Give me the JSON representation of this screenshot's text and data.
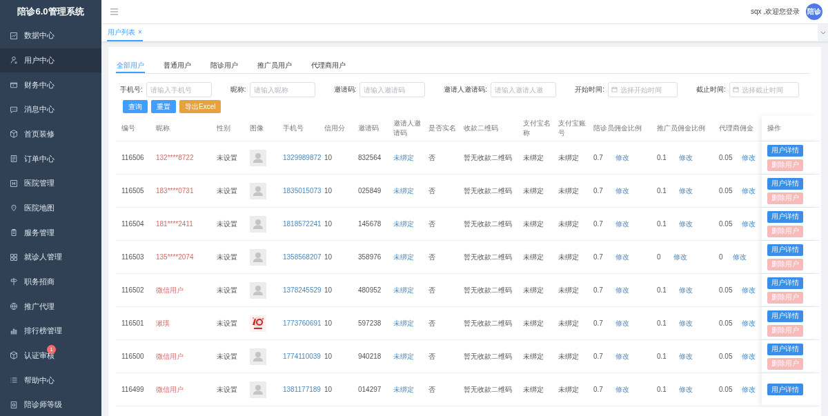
{
  "sidebar": {
    "title": "陪诊6.0管理系统",
    "items": [
      {
        "label": "数据中心",
        "selected": false
      },
      {
        "label": "用户中心",
        "selected": true
      },
      {
        "label": "财务中心",
        "selected": false
      },
      {
        "label": "消息中心",
        "selected": false
      },
      {
        "label": "首页装修",
        "selected": false
      },
      {
        "label": "订单中心",
        "selected": false
      },
      {
        "label": "医院管理",
        "selected": false
      },
      {
        "label": "医院地图",
        "selected": false
      },
      {
        "label": "服务管理",
        "selected": false
      },
      {
        "label": "就诊人管理",
        "selected": false
      },
      {
        "label": "职务招商",
        "selected": false
      },
      {
        "label": "推广代理",
        "selected": false
      },
      {
        "label": "排行榜管理",
        "selected": false
      },
      {
        "label": "认证审核",
        "selected": false,
        "badge": "1"
      },
      {
        "label": "帮助中心",
        "selected": false
      },
      {
        "label": "陪诊师等级",
        "selected": false
      }
    ]
  },
  "header": {
    "greeting": "sqx ,欢迎您登录",
    "avatar_text": "陪诊"
  },
  "page_tabs": [
    {
      "label": "用户列表",
      "selected": true,
      "close": "×"
    }
  ],
  "user_tabs": [
    {
      "label": "全部用户",
      "selected": true
    },
    {
      "label": "普通用户",
      "selected": false
    },
    {
      "label": "陪诊用户",
      "selected": false
    },
    {
      "label": "推广员用户",
      "selected": false
    },
    {
      "label": "代理商用户",
      "selected": false
    }
  ],
  "filters": [
    {
      "label": "手机号:",
      "placeholder": "请输入手机号",
      "kind": "text"
    },
    {
      "label": "昵称:",
      "placeholder": "请输入昵称",
      "kind": "text"
    },
    {
      "label": "邀请码:",
      "placeholder": "请输入邀请码",
      "kind": "text"
    },
    {
      "label": "邀请人邀请码:",
      "placeholder": "请输入邀请人邀",
      "kind": "text"
    },
    {
      "label": "开始时间:",
      "placeholder": "选择开始时间",
      "kind": "date"
    },
    {
      "label": "截止时间:",
      "placeholder": "选择截止时间",
      "kind": "date"
    }
  ],
  "buttons": [
    {
      "label": "查询",
      "kind": "primary"
    },
    {
      "label": "重置",
      "kind": "primary"
    },
    {
      "label": "导出Excel",
      "kind": "warning"
    }
  ],
  "table": {
    "columns": [
      "编号",
      "昵称",
      "性别",
      "图像",
      "手机号",
      "信用分",
      "邀请码",
      "邀请人邀请码",
      "是否实名",
      "收款二维码",
      "支付宝名称",
      "支付宝账号",
      "陪诊员佣金比例",
      "推广员佣金比例",
      "代理商佣金",
      "操作"
    ],
    "rows": [
      {
        "id": "116506",
        "nickname": "132****8722",
        "gender": "未设置",
        "avatar": {
          "kind": "placeholder"
        },
        "phone": "1329989872",
        "credit": "10",
        "invite_code": "832564",
        "inviter_code": "未绑定",
        "real_name": "否",
        "qr_code": "暂无收款二维码",
        "alipay_name": "未绑定",
        "alipay_account": "未绑定",
        "escort_rate": {
          "value": "0.7",
          "action": "修改"
        },
        "promoter_rate": {
          "value": "0.1",
          "action": "修改"
        },
        "agent_rate": {
          "value": "0.05",
          "action": "修改"
        },
        "actions": [
          {
            "label": "用户详情",
            "kind": "primary"
          },
          {
            "label": "删除用户",
            "kind": "danger"
          }
        ]
      },
      {
        "id": "116505",
        "nickname": "183****0731",
        "gender": "未设置",
        "avatar": {
          "kind": "placeholder"
        },
        "phone": "1835015073",
        "credit": "10",
        "invite_code": "025849",
        "inviter_code": "未绑定",
        "real_name": "否",
        "qr_code": "暂无收款二维码",
        "alipay_name": "未绑定",
        "alipay_account": "未绑定",
        "escort_rate": {
          "value": "0.7",
          "action": "修改"
        },
        "promoter_rate": {
          "value": "0.1",
          "action": "修改"
        },
        "agent_rate": {
          "value": "0.05",
          "action": "修改"
        },
        "actions": [
          {
            "label": "用户详情",
            "kind": "primary"
          },
          {
            "label": "删除用户",
            "kind": "danger"
          }
        ]
      },
      {
        "id": "116504",
        "nickname": "181****2411",
        "gender": "未设置",
        "avatar": {
          "kind": "placeholder"
        },
        "phone": "1818572241",
        "credit": "10",
        "invite_code": "145678",
        "inviter_code": "未绑定",
        "real_name": "否",
        "qr_code": "暂无收款二维码",
        "alipay_name": "未绑定",
        "alipay_account": "未绑定",
        "escort_rate": {
          "value": "0.7",
          "action": "修改"
        },
        "promoter_rate": {
          "value": "0.1",
          "action": "修改"
        },
        "agent_rate": {
          "value": "0.05",
          "action": "修改"
        },
        "actions": [
          {
            "label": "用户详情",
            "kind": "primary"
          },
          {
            "label": "删除用户",
            "kind": "danger"
          }
        ]
      },
      {
        "id": "116503",
        "nickname": "135****2074",
        "gender": "未设置",
        "avatar": {
          "kind": "placeholder"
        },
        "phone": "1358568207",
        "credit": "10",
        "invite_code": "358976",
        "inviter_code": "未绑定",
        "real_name": "否",
        "qr_code": "暂无收款二维码",
        "alipay_name": "未绑定",
        "alipay_account": "未绑定",
        "escort_rate": {
          "value": "0.7",
          "action": "修改"
        },
        "promoter_rate": {
          "value": "0",
          "action": "修改"
        },
        "agent_rate": {
          "value": "0",
          "action": "修改"
        },
        "actions": [
          {
            "label": "用户详情",
            "kind": "primary"
          },
          {
            "label": "删除用户",
            "kind": "danger"
          }
        ]
      },
      {
        "id": "116502",
        "nickname": "微信用户",
        "gender": "未设置",
        "avatar": {
          "kind": "placeholder"
        },
        "phone": "1378245529",
        "credit": "10",
        "invite_code": "480952",
        "inviter_code": "未绑定",
        "real_name": "否",
        "qr_code": "暂无收款二维码",
        "alipay_name": "未绑定",
        "alipay_account": "未绑定",
        "escort_rate": {
          "value": "0.7",
          "action": "修改"
        },
        "promoter_rate": {
          "value": "0.1",
          "action": "修改"
        },
        "agent_rate": {
          "value": "0.05",
          "action": "修改"
        },
        "actions": [
          {
            "label": "用户详情",
            "kind": "primary"
          },
          {
            "label": "删除用户",
            "kind": "danger"
          }
        ]
      },
      {
        "id": "116501",
        "nickname": "湫璞",
        "gender": "未设置",
        "avatar": {
          "kind": "picture"
        },
        "phone": "1773760691",
        "credit": "10",
        "invite_code": "597238",
        "inviter_code": "未绑定",
        "real_name": "否",
        "qr_code": "暂无收款二维码",
        "alipay_name": "未绑定",
        "alipay_account": "未绑定",
        "escort_rate": {
          "value": "0.7",
          "action": "修改"
        },
        "promoter_rate": {
          "value": "0.1",
          "action": "修改"
        },
        "agent_rate": {
          "value": "0.05",
          "action": "修改"
        },
        "actions": [
          {
            "label": "用户详情",
            "kind": "primary"
          },
          {
            "label": "删除用户",
            "kind": "danger"
          }
        ]
      },
      {
        "id": "116500",
        "nickname": "微信用户",
        "gender": "未设置",
        "avatar": {
          "kind": "placeholder"
        },
        "phone": "1774110039",
        "credit": "10",
        "invite_code": "940218",
        "inviter_code": "未绑定",
        "real_name": "否",
        "qr_code": "暂无收款二维码",
        "alipay_name": "未绑定",
        "alipay_account": "未绑定",
        "escort_rate": {
          "value": "0.7",
          "action": "修改"
        },
        "promoter_rate": {
          "value": "0.1",
          "action": "修改"
        },
        "agent_rate": {
          "value": "0.05",
          "action": "修改"
        },
        "actions": [
          {
            "label": "用户详情",
            "kind": "primary"
          },
          {
            "label": "删除用户",
            "kind": "danger"
          }
        ]
      },
      {
        "id": "116499",
        "nickname": "微信用户",
        "gender": "未设置",
        "avatar": {
          "kind": "placeholder"
        },
        "phone": "1381177189",
        "credit": "10",
        "invite_code": "014297",
        "inviter_code": "未绑定",
        "real_name": "否",
        "qr_code": "暂无收款二维码",
        "alipay_name": "未绑定",
        "alipay_account": "未绑定",
        "escort_rate": {
          "value": "0.7",
          "action": "修改"
        },
        "promoter_rate": {
          "value": "0.1",
          "action": "修改"
        },
        "agent_rate": {
          "value": "0.05",
          "action": "修改"
        },
        "actions": [
          {
            "label": "用户详情",
            "kind": "primary"
          }
        ]
      }
    ]
  }
}
